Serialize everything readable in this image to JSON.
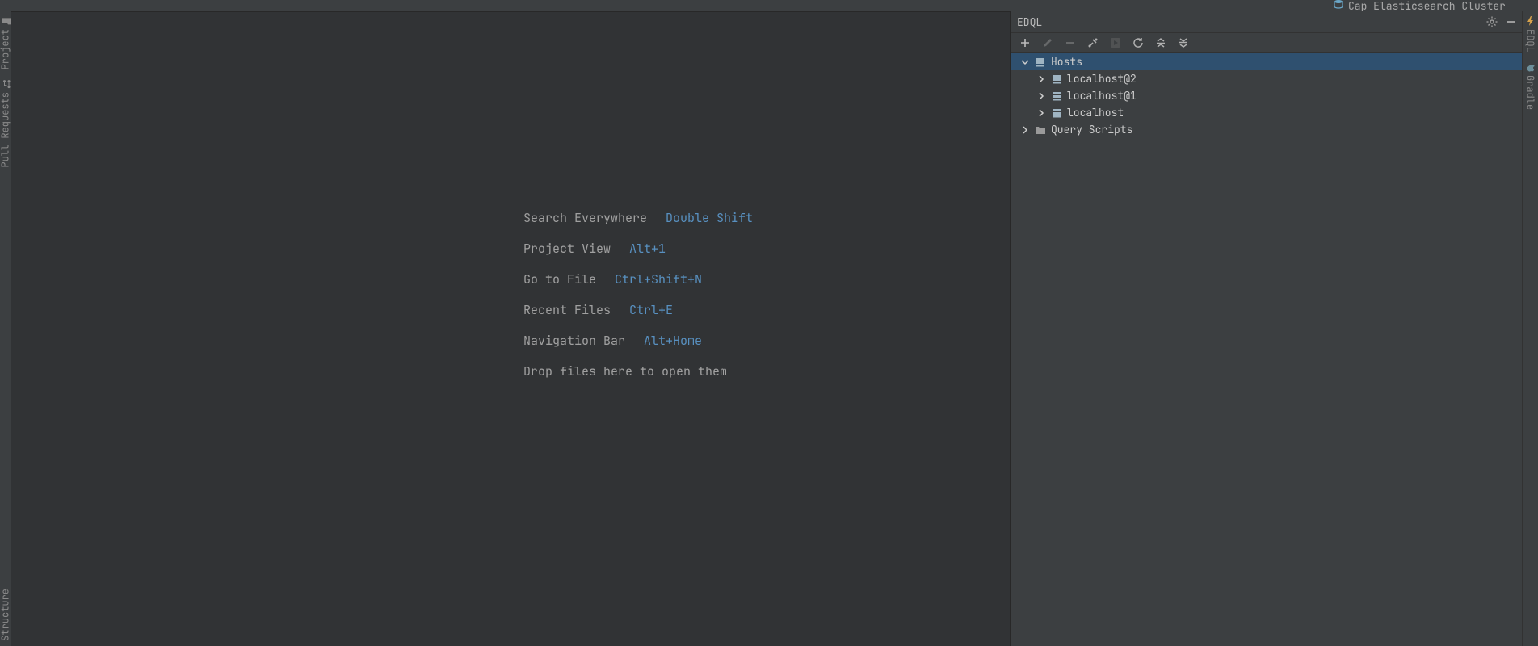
{
  "topbar": {
    "cap_label": "Cap Elasticsearch Cluster"
  },
  "left_strip": {
    "tabs": [
      {
        "label": "Project"
      },
      {
        "label": "Pull Requests"
      },
      {
        "label": "Structure"
      }
    ]
  },
  "editor_hints": {
    "rows": [
      {
        "label": "Search Everywhere",
        "shortcut": "Double Shift"
      },
      {
        "label": "Project View",
        "shortcut": "Alt+1"
      },
      {
        "label": "Go to File",
        "shortcut": "Ctrl+Shift+N"
      },
      {
        "label": "Recent Files",
        "shortcut": "Ctrl+E"
      },
      {
        "label": "Navigation Bar",
        "shortcut": "Alt+Home"
      }
    ],
    "drop_hint": "Drop files here to open them"
  },
  "panel": {
    "title": "EDQL",
    "tree": {
      "hosts_label": "Hosts",
      "hosts_children": [
        {
          "label": "localhost@2"
        },
        {
          "label": "localhost@1"
        },
        {
          "label": "localhost"
        }
      ],
      "query_scripts_label": "Query Scripts"
    }
  },
  "right_strip": {
    "tabs": [
      {
        "label": "EDQL"
      },
      {
        "label": "Gradle"
      }
    ]
  }
}
